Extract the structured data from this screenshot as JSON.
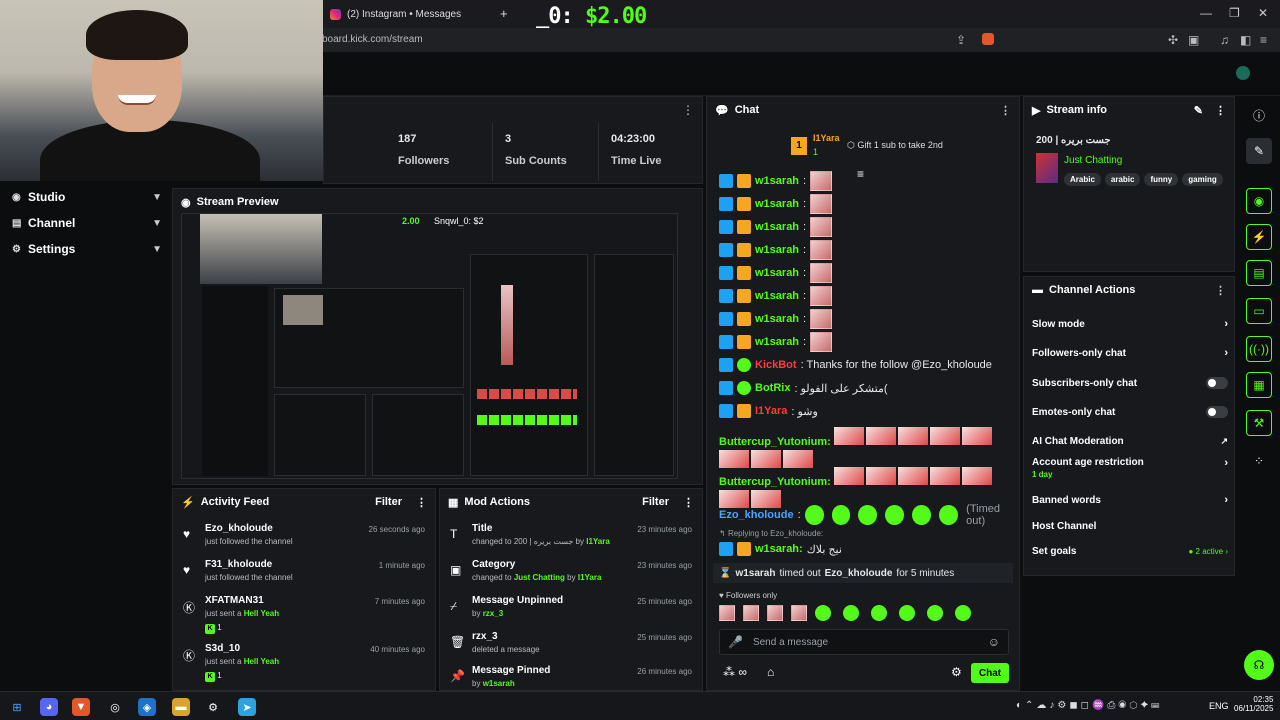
{
  "browser": {
    "tab_title": "(2) Instagram • Messages",
    "url": "board.kick.com/stream",
    "donation_prefix": "_0:",
    "donation_amount": "$2.00"
  },
  "sidebar": {
    "items": [
      {
        "label": "Studio"
      },
      {
        "label": "Channel"
      },
      {
        "label": "Settings"
      }
    ]
  },
  "stats": [
    {
      "value": "187",
      "label": "Followers"
    },
    {
      "value": "3",
      "label": "Sub Counts"
    },
    {
      "value": "04:23:00",
      "label": "Time Live"
    }
  ],
  "preview": {
    "title": "Stream Preview",
    "nested_amount": "2.00",
    "nested_text": "Snqwl_0: $2"
  },
  "activity": {
    "title": "Activity Feed",
    "filter": "Filter",
    "rows": [
      {
        "name": "Ezo_kholoude",
        "desc": "just followed the channel",
        "time": "26 seconds ago"
      },
      {
        "name": "F31_kholoude",
        "desc": "just followed the channel",
        "time": "1 minute ago"
      },
      {
        "name": "XFATMAN31",
        "desc": "just sent a",
        "item": "Hell Yeah",
        "count": "1",
        "time": "7 minutes ago"
      },
      {
        "name": "S3d_10",
        "desc": "just sent a",
        "item": "Hell Yeah",
        "count": "1",
        "time": "40 minutes ago"
      }
    ]
  },
  "mod": {
    "title": "Mod Actions",
    "filter": "Filter",
    "rows": [
      {
        "name": "Title",
        "desc": "changed to 200 | جست بريره by",
        "by": "I1Yara",
        "time": "23 minutes ago"
      },
      {
        "name": "Category",
        "desc": "changed to",
        "cat": "Just Chatting",
        "by_prefix": "by",
        "by": "I1Yara",
        "time": "23 minutes ago"
      },
      {
        "name": "Message Unpinned",
        "desc": "by",
        "by": "rzx_3",
        "time": "25 minutes ago"
      },
      {
        "name": "rzx_3",
        "desc": "deleted a message",
        "time": "25 minutes ago"
      },
      {
        "name": "Message Pinned",
        "desc": "by",
        "by": "w1sarah",
        "time": "26 minutes ago"
      }
    ]
  },
  "chat": {
    "title": "Chat",
    "top_user": "I1Yara",
    "top_count": "1",
    "gift_text": "Gift 1 sub to take 2nd",
    "repeat_user": "w1sarah",
    "kickbot_user": "KickBot",
    "kickbot_msg": "Thanks for the follow @Ezo_kholoude",
    "botrix_user": "BotRix",
    "botrix_msg": "متشكر على الفولو(",
    "yara_user": "I1Yara",
    "yara_msg": "وشو",
    "butter_user": "Buttercup_Yutonium:",
    "ezo_user": "Ezo_kholoude",
    "timed_out": "(Timed out)",
    "reply_to": "Replying to Ezo_kholoude:",
    "w1_reply": "w1sarah:",
    "w1_reply_msg": "نيج بلاك",
    "timeout_notice_user": "w1sarah",
    "timeout_notice_mid": "timed out",
    "timeout_notice_target": "Ezo_kholoude",
    "timeout_notice_end": "for 5 minutes",
    "followers_only": "Followers only",
    "input_placeholder": "Send a message",
    "send_label": "Chat"
  },
  "stream_info": {
    "title": "Stream info",
    "stream_title": "200 | جست بريره",
    "category": "Just Chatting",
    "tags": [
      "Arabic",
      "arabic",
      "funny",
      "gaming"
    ]
  },
  "channel_actions": {
    "title": "Channel Actions",
    "items": [
      {
        "label": "Slow mode"
      },
      {
        "label": "Followers-only chat"
      },
      {
        "label": "Subscribers-only chat"
      },
      {
        "label": "Emotes-only chat"
      },
      {
        "label": "AI Chat Moderation"
      },
      {
        "label": "Account age restriction",
        "sub": "1 day"
      },
      {
        "label": "Banned words"
      },
      {
        "label": "Host Channel"
      },
      {
        "label": "Set goals",
        "sub": "2 active"
      }
    ]
  },
  "taskbar": {
    "lang": "ENG",
    "time": "02:35",
    "date": "06/11/2025"
  },
  "colors": {
    "accent": "#53fc18",
    "bg": "#0b0d0f",
    "panel": "#17191c"
  }
}
